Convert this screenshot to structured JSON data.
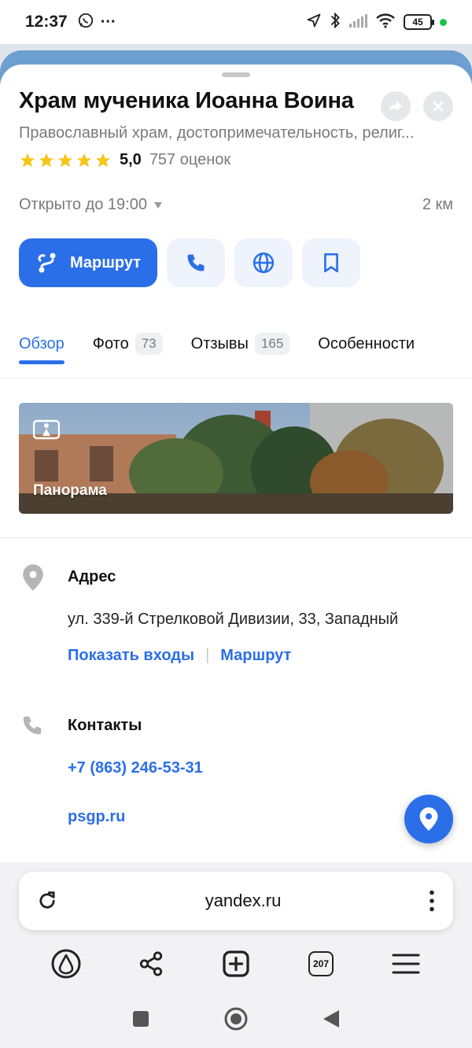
{
  "status_bar": {
    "time": "12:37",
    "extra": "···",
    "battery": "45"
  },
  "place": {
    "title": "Храм мученика Иоанна Воина",
    "subtitle": "Православный храм, достопримечательность, религ...",
    "rating": "5,0",
    "reviews_count": "757 оценок",
    "stars": 5,
    "hours": "Открыто до 19:00",
    "distance": "2 км"
  },
  "actions": {
    "route_label": "Маршрут"
  },
  "tabs": [
    {
      "label": "Обзор",
      "count": ""
    },
    {
      "label": "Фото",
      "count": "73"
    },
    {
      "label": "Отзывы",
      "count": "165"
    },
    {
      "label": "Особенности",
      "count": ""
    }
  ],
  "panorama": {
    "label": "Панорама"
  },
  "address": {
    "title": "Адрес",
    "text": "ул. 339-й Стрелковой Дивизии, 33, Западный",
    "show_entrances": "Показать входы",
    "separator": "|",
    "route": "Маршрут"
  },
  "contacts": {
    "title": "Контакты",
    "phone": "+7 (863) 246-53-31",
    "site": "psgp.ru"
  },
  "browser": {
    "url": "yandex.ru",
    "tabs_count": "207"
  },
  "colors": {
    "accent": "#2b6fe8",
    "star": "#f5c518",
    "muted": "#7a7a7a"
  }
}
